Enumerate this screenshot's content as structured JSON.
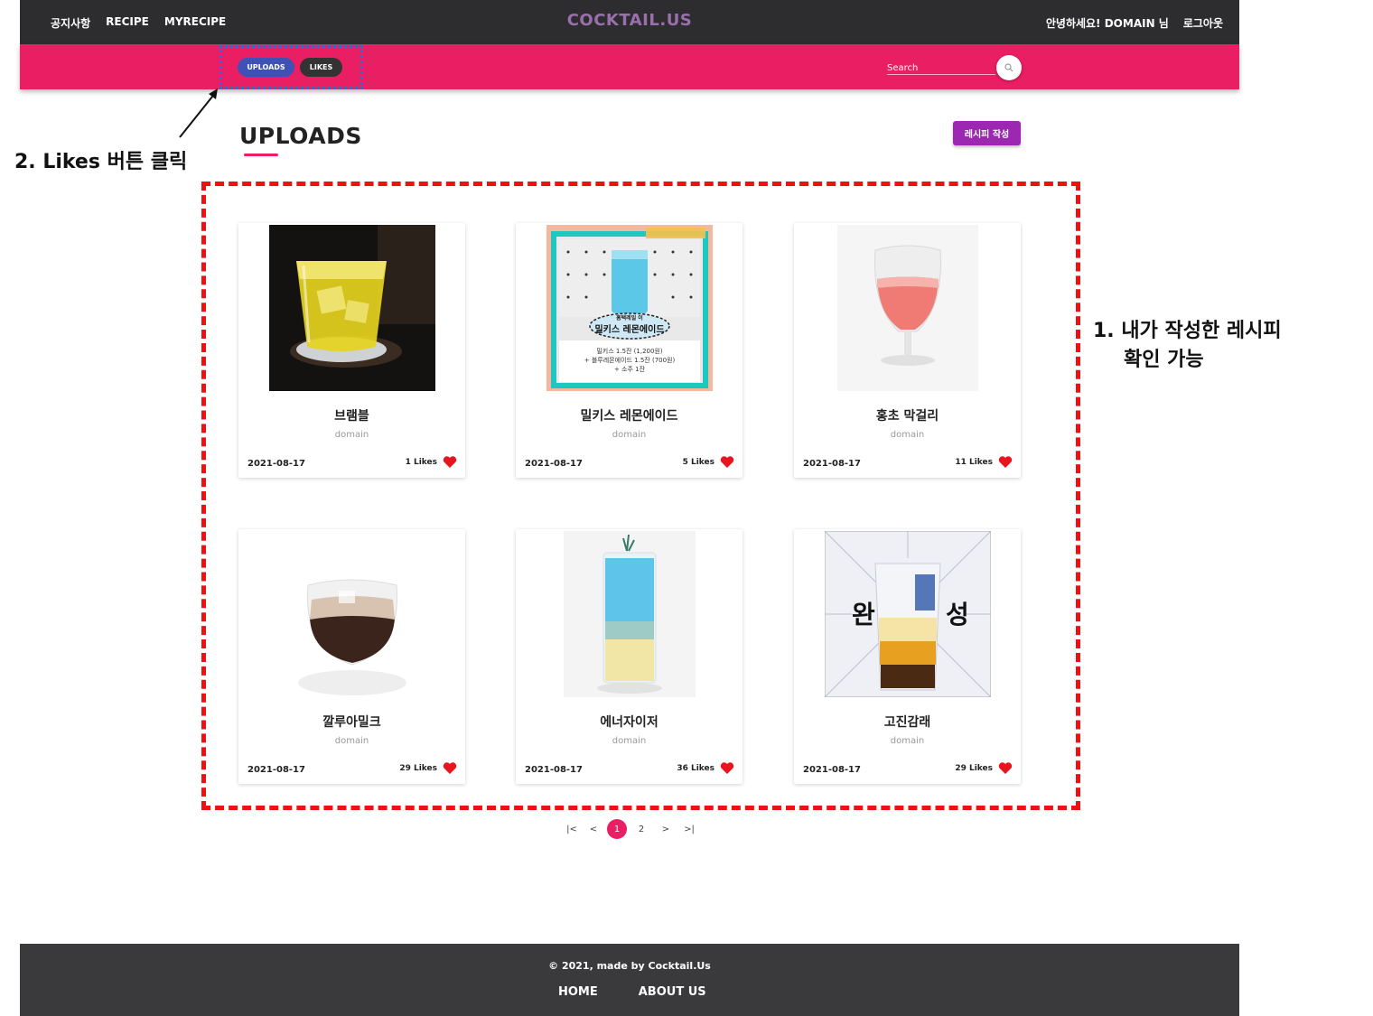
{
  "header": {
    "nav_left": [
      "공지사항",
      "RECIPE",
      "MYRECIPE"
    ],
    "logo": "COCKTAIL.US",
    "greeting": "안녕하세요! DOMAIN 님",
    "logout": "로그아웃"
  },
  "subnav": {
    "uploads_label": "UPLOADS",
    "likes_label": "LIKES",
    "search_placeholder": "Search"
  },
  "main": {
    "title": "UPLOADS",
    "write_button": "레시피 작성",
    "cards": [
      {
        "name": "브램블",
        "author": "domain",
        "date": "2021-08-17",
        "likes": "1 Likes"
      },
      {
        "name": "밀키스 레몬에이드",
        "author": "domain",
        "date": "2021-08-17",
        "likes": "5 Likes"
      },
      {
        "name": "홍초 막걸리",
        "author": "domain",
        "date": "2021-08-17",
        "likes": "11 Likes"
      },
      {
        "name": "깔루아밀크",
        "author": "domain",
        "date": "2021-08-17",
        "likes": "29 Likes"
      },
      {
        "name": "에너자이저",
        "author": "domain",
        "date": "2021-08-17",
        "likes": "36 Likes"
      },
      {
        "name": "고진감래",
        "author": "domain",
        "date": "2021-08-17",
        "likes": "29 Likes"
      }
    ],
    "card_image_text": {
      "milkis_top": "밀키스 레몬에이드",
      "milkis_sub": "홈택레일 이",
      "milkis_l1": "밀키스 1.5잔 (1,200원)",
      "milkis_l2": "+ 블루레몬에이드 1.5잔 (700원)",
      "milkis_l3": "+ 소주 1잔",
      "gojin_left": "완",
      "gojin_right": "성"
    }
  },
  "pagination": {
    "first": "|<",
    "prev": "<",
    "pages": [
      "1",
      "2"
    ],
    "next": ">",
    "last": ">|",
    "current": "1"
  },
  "footer": {
    "copyright": "© 2021, made by Cocktail.Us",
    "links": [
      "HOME",
      "ABOUT US"
    ]
  },
  "annotations": {
    "likes_note": "2. Likes 버튼 클릭",
    "uploads_note_line1": "1.  내가 작성한 레시피",
    "uploads_note_line2": "확인 가능"
  },
  "colors": {
    "topbar": "#2d2d2f",
    "accent": "#e91e63",
    "uploads_pill": "#3f51b5",
    "write_button": "#9c27b0",
    "heart": "#e8141e"
  }
}
